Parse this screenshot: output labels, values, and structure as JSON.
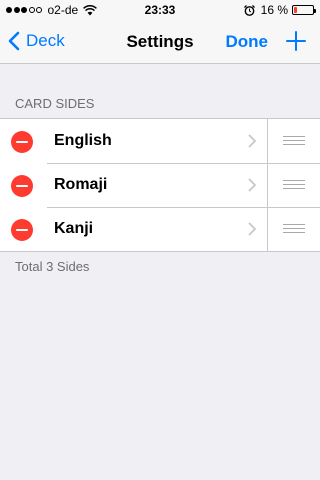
{
  "status_bar": {
    "carrier": "o2-de",
    "time": "23:33",
    "battery_percent": "16 %",
    "battery_level": 0.16,
    "signal_dots": 5,
    "signal_filled": 3
  },
  "nav": {
    "back_label": "Deck",
    "title": "Settings",
    "done_label": "Done",
    "add_icon": "plus-icon"
  },
  "section": {
    "header": "CARD SIDES",
    "rows": [
      {
        "label": "English"
      },
      {
        "label": "Romaji"
      },
      {
        "label": "Kanji"
      }
    ],
    "footer": "Total 3 Sides"
  },
  "colors": {
    "accent": "#007aff",
    "delete": "#ff3b30",
    "background": "#efeff4"
  }
}
